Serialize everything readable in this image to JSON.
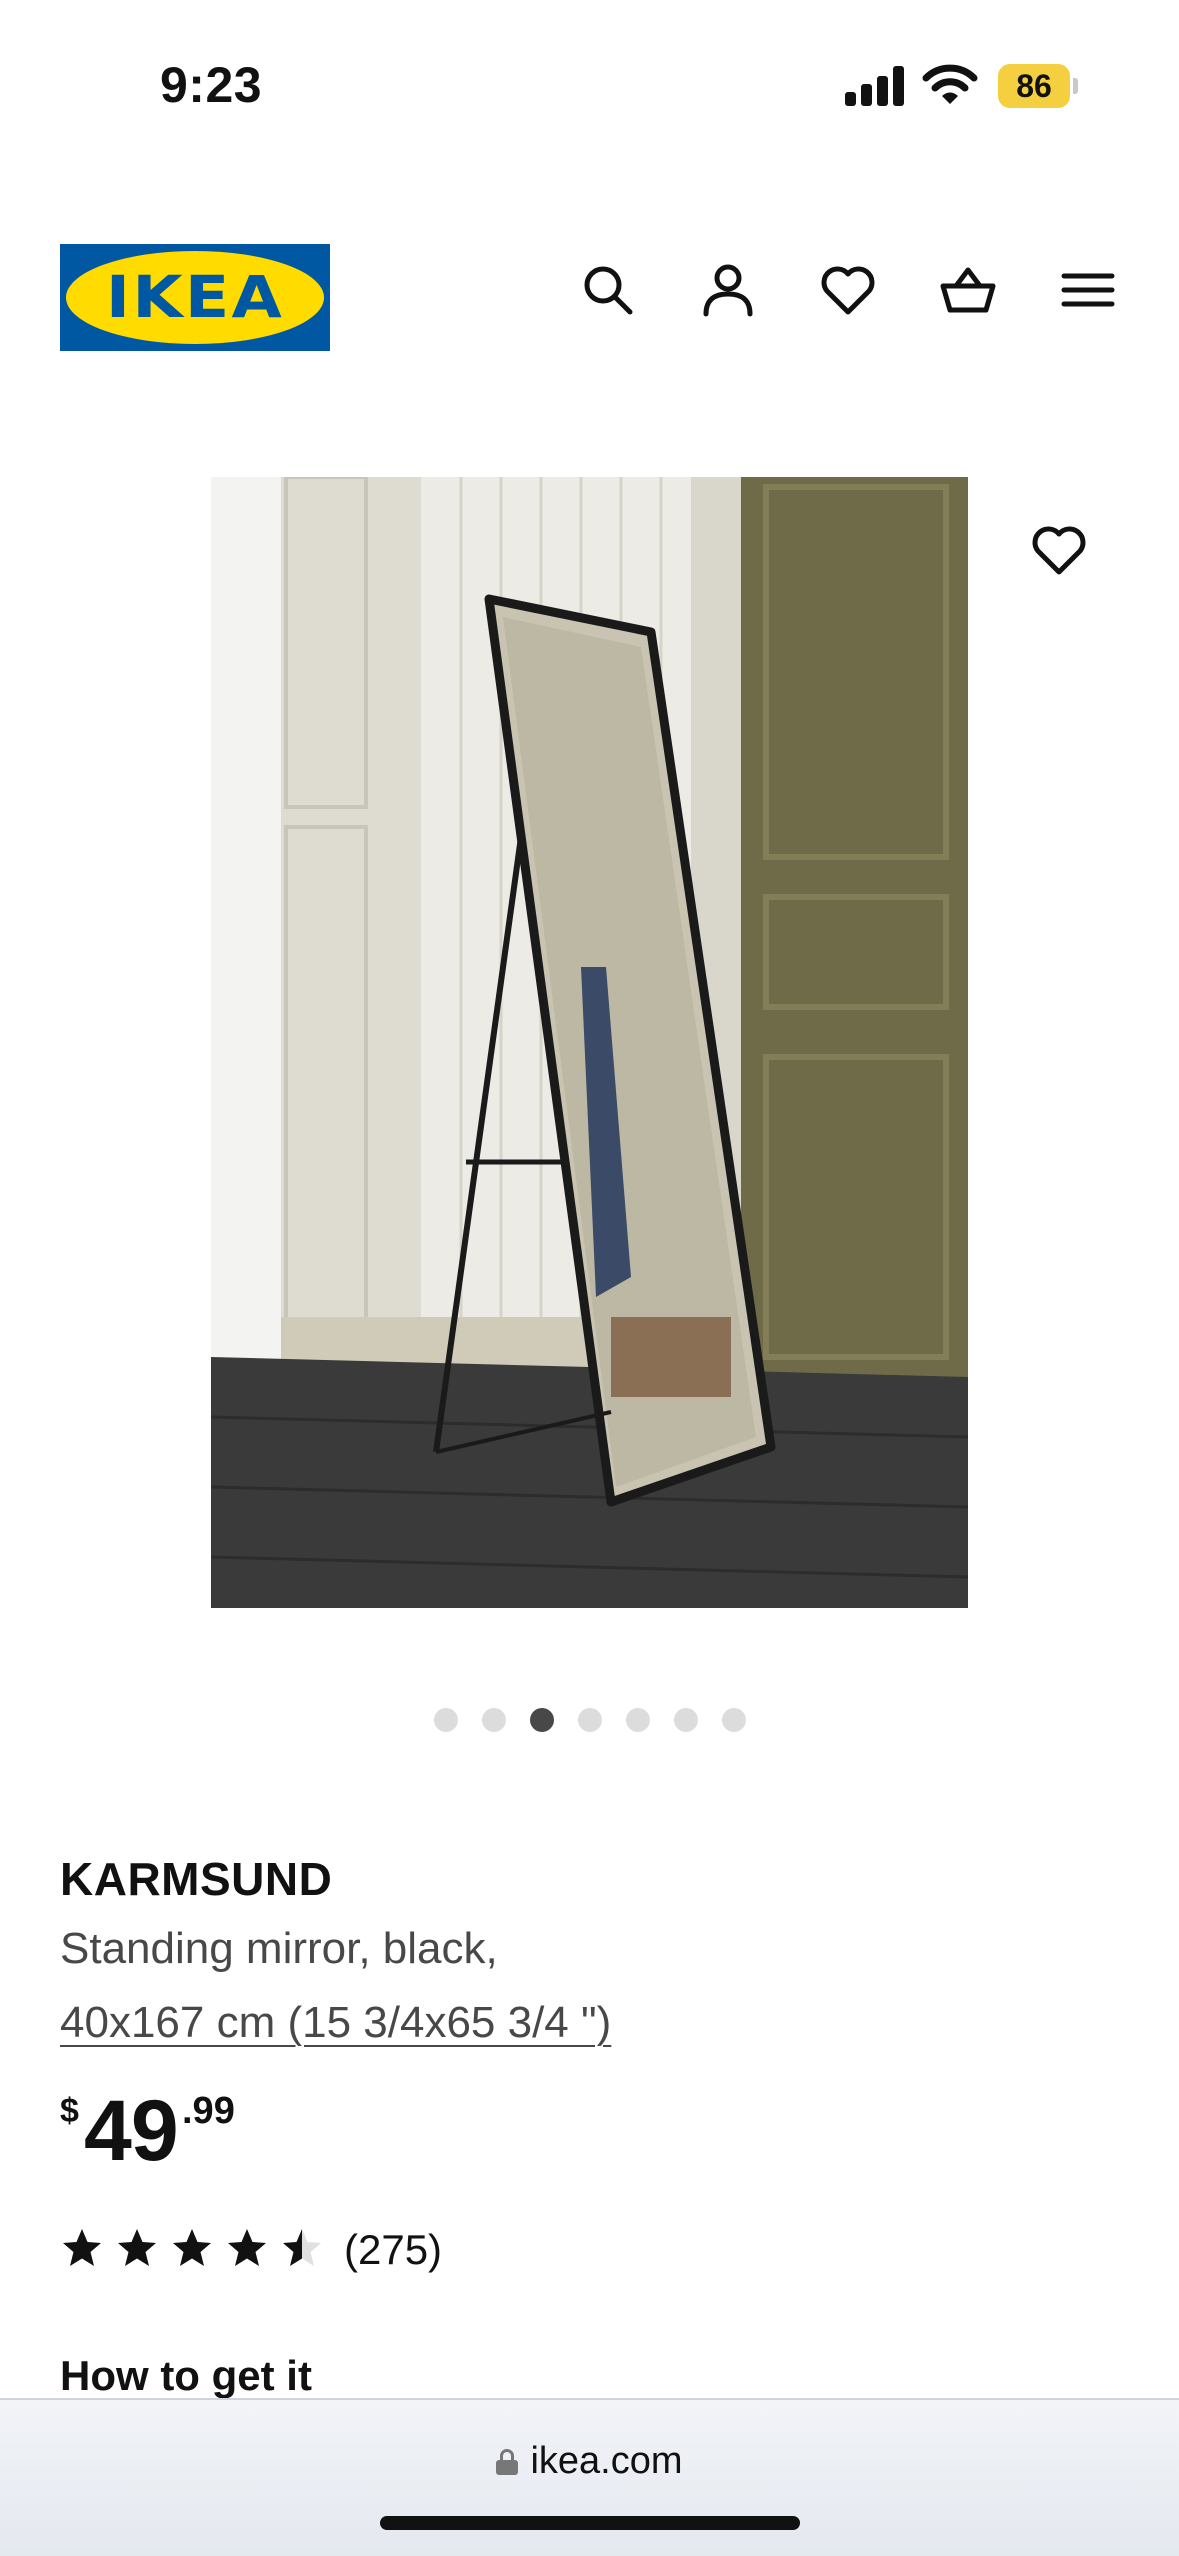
{
  "status_bar": {
    "time": "9:23",
    "battery_level": "86",
    "battery_color": "#f4cf3f",
    "icons": [
      "signal-icon",
      "wifi-icon",
      "battery-icon"
    ]
  },
  "header": {
    "logo_text": "IKEA",
    "logo_colors": {
      "background": "#0058a3",
      "oval": "#ffdb00"
    },
    "icons": [
      "search-icon",
      "account-icon",
      "heart-icon",
      "cart-icon",
      "menu-icon"
    ]
  },
  "gallery": {
    "image_description": "black standing mirror",
    "image_count": 7,
    "active_index": 3,
    "favorite_icon": "heart-icon"
  },
  "product": {
    "name": "KARMSUND",
    "description": "Standing mirror, black,",
    "size": "40x167 cm (15 3/4x65 3/4 \")",
    "price_currency": "$",
    "price_integer": "49",
    "price_decimal": ".99",
    "rating": 4.5,
    "rating_max": 5,
    "review_count": "(275)"
  },
  "sections": {
    "how_to_get_it": "How to get it"
  },
  "browser": {
    "url": "ikea.com",
    "lock_icon": "lock-icon"
  }
}
